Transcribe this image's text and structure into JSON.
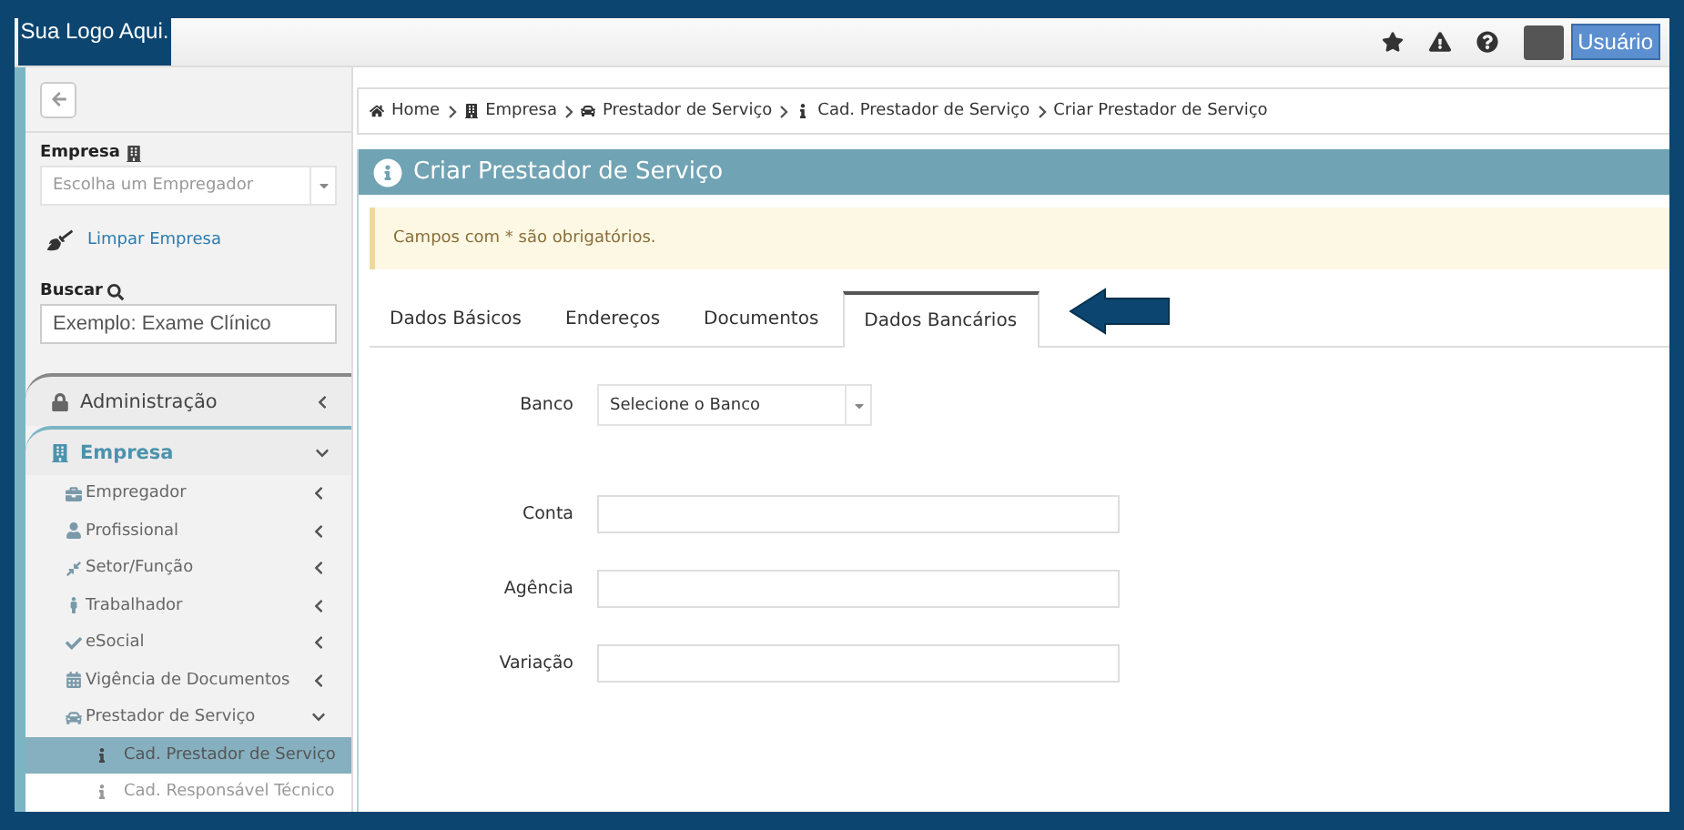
{
  "logo": {
    "text": "Sua Logo Aqui."
  },
  "topbar": {
    "user_label": "Usuário"
  },
  "sidebar": {
    "company_label": "Empresa",
    "company_select": {
      "placeholder": "Escolha um Empregador"
    },
    "clear_link": "Limpar Empresa",
    "search_label": "Buscar",
    "search": {
      "placeholder": "Exemplo: Exame Clínico"
    },
    "menu": [
      {
        "label": "Administração",
        "expanded": false
      },
      {
        "label": "Empresa",
        "expanded": true,
        "children": [
          {
            "label": "Empregador",
            "expanded": false
          },
          {
            "label": "Profissional",
            "expanded": false
          },
          {
            "label": "Setor/Função",
            "expanded": false
          },
          {
            "label": "Trabalhador",
            "expanded": false
          },
          {
            "label": "eSocial",
            "expanded": false
          },
          {
            "label": "Vigência de Documentos",
            "expanded": false
          },
          {
            "label": "Prestador de Serviço",
            "expanded": true,
            "children": [
              {
                "label": "Cad. Prestador de Serviço",
                "selected": true
              },
              {
                "label": "Cad. Responsável Técnico",
                "selected": false
              }
            ]
          }
        ]
      }
    ]
  },
  "breadcrumb": [
    "Home",
    "Empresa",
    "Prestador de Serviço",
    "Cad. Prestador de Serviço",
    "Criar Prestador de Serviço"
  ],
  "page_title": "Criar Prestador de Serviço",
  "alert": "Campos com * são obrigatórios.",
  "tabs": [
    {
      "label": "Dados Básicos",
      "selected": false
    },
    {
      "label": "Endereços",
      "selected": false
    },
    {
      "label": "Documentos",
      "selected": false
    },
    {
      "label": "Dados Bancários",
      "selected": true
    }
  ],
  "form": {
    "bank": {
      "label": "Banco",
      "placeholder": "Selecione o Banco"
    },
    "fields": [
      {
        "label": "Conta"
      },
      {
        "label": "Agência"
      },
      {
        "label": "Variação"
      }
    ]
  }
}
